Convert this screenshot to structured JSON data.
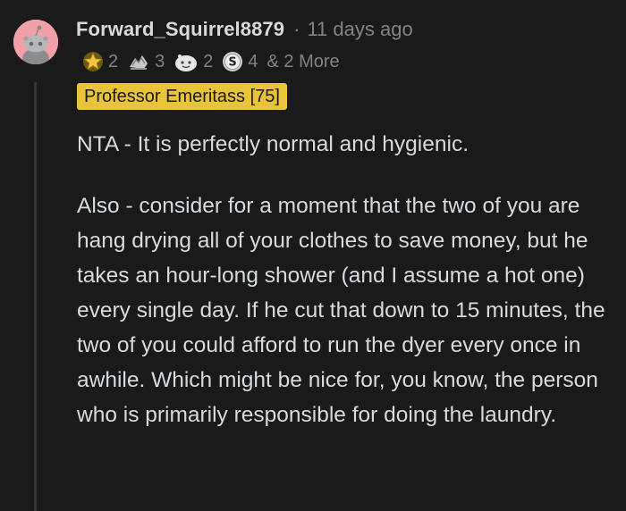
{
  "comment": {
    "username": "Forward_Squirrel8879",
    "separator": "·",
    "timestamp": "11 days ago",
    "awards": [
      {
        "icon": "star-award-icon",
        "count": "2"
      },
      {
        "icon": "helpful-hands-award-icon",
        "count": "3"
      },
      {
        "icon": "wholesome-face-award-icon",
        "count": "2"
      },
      {
        "icon": "silver-coin-award-icon",
        "count": "4"
      }
    ],
    "more_awards": "& 2 More",
    "flair": "Professor Emeritass [75]",
    "paragraphs": [
      "NTA - It is perfectly normal and hygienic.",
      "Also - consider for a moment that the two of you are hang drying all of your clothes to save money, but he takes an hour-long shower (and I assume a hot one) every single day. If he cut that down to 15 minutes, the two of you could afford to run the dyer every once in awhile. Which might be nice for, you know, the person who is primarily responsible for doing the laundry."
    ]
  },
  "colors": {
    "background": "#1a1a1b",
    "text": "#d7dadc",
    "muted": "#818384",
    "flair_bg": "#e9c43a",
    "avatar_bg": "#f2a0a8"
  }
}
